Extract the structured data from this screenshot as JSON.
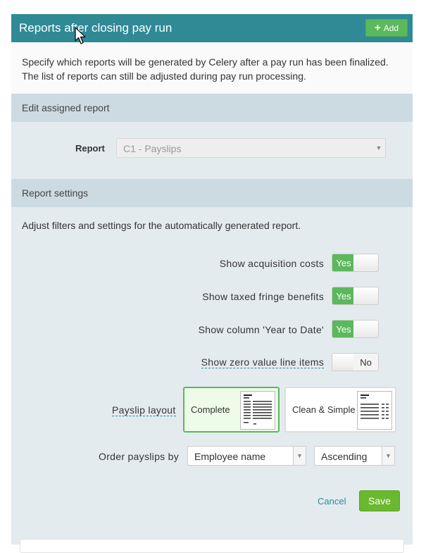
{
  "panel": {
    "title": "Reports after closing pay run",
    "add_label": "Add"
  },
  "intro": {
    "line1": "Specify which reports will be generated by Celery after a pay run has been finalized.",
    "line2": "The list of reports can still be adjusted during pay run processing."
  },
  "edit_section": {
    "title": "Edit assigned report",
    "report_label": "Report",
    "report_value": "C1 - Payslips"
  },
  "settings_section": {
    "title": "Report settings",
    "description": "Adjust filters and settings for the automatically generated report.",
    "toggles": [
      {
        "label": "Show acquisition costs",
        "value": "Yes"
      },
      {
        "label": "Show taxed fringe benefits",
        "value": "Yes"
      },
      {
        "label": "Show column 'Year to Date'",
        "value": "Yes"
      },
      {
        "label": "Show zero value line items",
        "value": "No"
      }
    ],
    "layout_label": "Payslip layout",
    "layouts": [
      {
        "label": "Complete",
        "selected": true
      },
      {
        "label": "Clean & Simple",
        "selected": false
      }
    ],
    "order_label": "Order payslips by",
    "order_by": "Employee name",
    "order_direction": "Ascending"
  },
  "actions": {
    "cancel": "Cancel",
    "save": "Save"
  },
  "colors": {
    "header": "#2f8a96",
    "accent_green": "#5cb85c",
    "save_green": "#6ab82e"
  }
}
